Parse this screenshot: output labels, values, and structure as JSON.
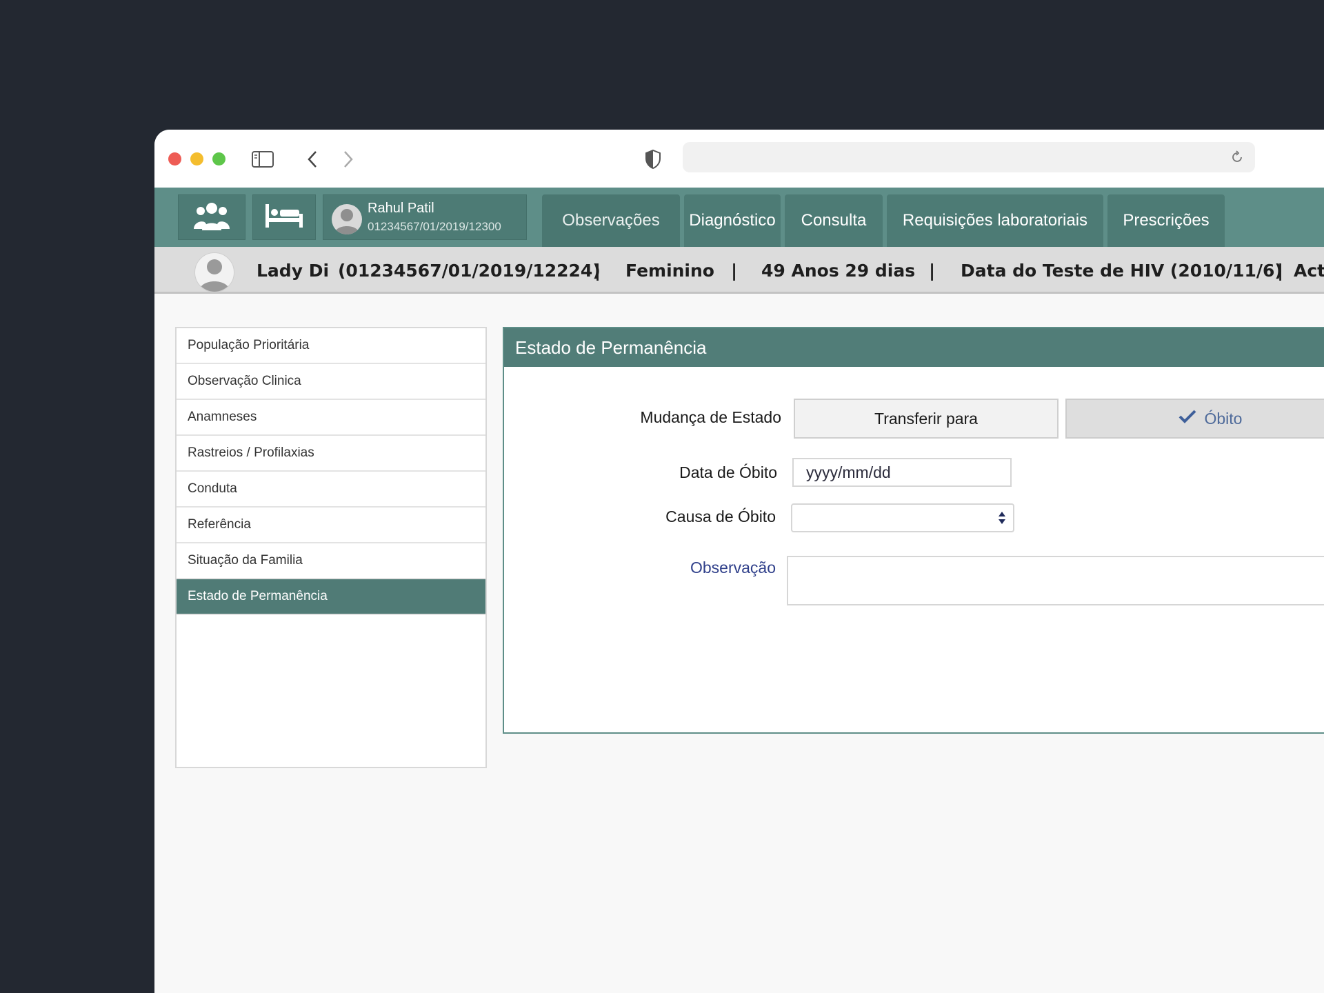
{
  "app": {
    "nav": {
      "user": {
        "name": "Rahul Patil",
        "id": "01234567/01/2019/12300"
      },
      "tabs": [
        {
          "label": "Observações",
          "active": true
        },
        {
          "label": "Diagnóstico",
          "active": false
        },
        {
          "label": "Consulta",
          "active": false
        },
        {
          "label": "Requisições laboratoriais",
          "active": false
        },
        {
          "label": "Prescrições",
          "active": false
        }
      ]
    },
    "patient": {
      "name": "Lady Di",
      "id": "(01234567/01/2019/12224)",
      "gender": "Feminino",
      "age": "49 Anos 29 dias",
      "hiv_test": "Data do Teste de HIV (2010/11/6)",
      "extra": "Act",
      "separator": "|"
    },
    "sidebar": {
      "items": [
        {
          "label": "População Prioritária"
        },
        {
          "label": "Observação Clinica"
        },
        {
          "label": "Anamneses"
        },
        {
          "label": "Rastreios / Profilaxias"
        },
        {
          "label": "Conduta"
        },
        {
          "label": "Referência"
        },
        {
          "label": "Situação da Familia"
        },
        {
          "label": "Estado de Permanência",
          "active": true
        }
      ]
    },
    "panel": {
      "title": "Estado de Permanência",
      "mudanca_label": "Mudança de Estado",
      "transfer_label": "Transferir para",
      "obito_label": "Óbito",
      "data_label": "Data de Óbito",
      "data_placeholder": "yyyy/mm/dd",
      "causa_label": "Causa de Óbito",
      "obs_label": "Observação"
    }
  },
  "colors": {
    "teal": "#5e8e88",
    "teal_dark": "#4d7b75",
    "link_blue": "#2f3f8a"
  }
}
